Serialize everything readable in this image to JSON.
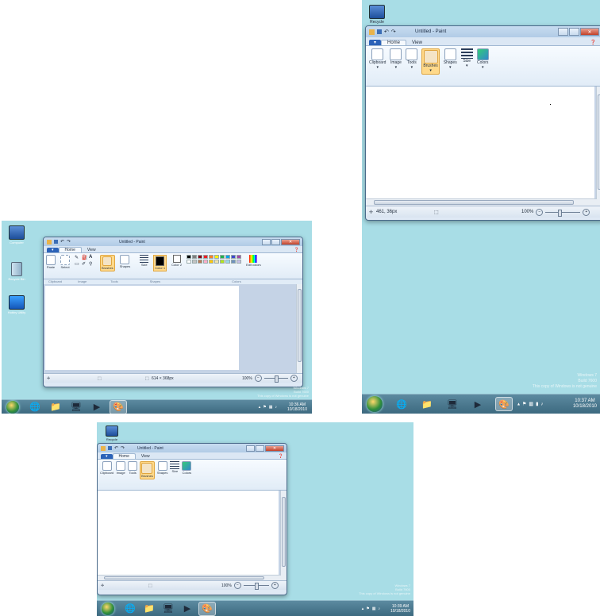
{
  "paint": {
    "title": "Untitled - Paint",
    "tabs": {
      "file": "▾",
      "home": "Home",
      "view": "View"
    },
    "ribbon_small": [
      "Clipboard",
      "Image",
      "Tools",
      "Brushes",
      "Shapes",
      "Size",
      "Colors"
    ],
    "ribbon_full": {
      "paste": "Paste",
      "select": "Select",
      "brushes": "Brushes",
      "shapes": "Shapes",
      "size": "Size",
      "color1": "Color 1",
      "color2": "Color 2",
      "edit_colors": "Edit colors",
      "groups": [
        "Clipboard",
        "Image",
        "Tools",
        "Shapes",
        "Colors"
      ]
    },
    "help_icon": "help-icon"
  },
  "shot1": {
    "desktop_icons": [
      "Computer",
      "Recycle Bin",
      "Hobby Utility"
    ],
    "status_size": "614 × 368px",
    "zoom": "100%",
    "watermark": [
      "Windows 7",
      "Build 7600",
      "This copy of Windows is not genuine"
    ],
    "clock": [
      "10:36 AM",
      "10/18/2010"
    ]
  },
  "shot2": {
    "desktop_icon": "Recycle",
    "status_pos": "461, 36px",
    "zoom": "100%",
    "watermark": [
      "Windows 7",
      "Build 7600",
      "This copy of Windows is not genuine"
    ],
    "clock": [
      "10:37 AM",
      "10/18/2010"
    ]
  },
  "shot3": {
    "desktop_icon": "Recycle",
    "zoom": "100%",
    "watermark": [
      "Windows 7",
      "Build 7600",
      "This copy of Windows is not genuine"
    ],
    "clock": [
      "10:39 AM",
      "10/18/2010"
    ]
  },
  "colors": {
    "desktop": "#a8dde6",
    "palette": [
      "#000000",
      "#7f7f7f",
      "#880015",
      "#ed1c24",
      "#ff7f27",
      "#fff200",
      "#22b14c",
      "#00a2e8",
      "#3f48cc",
      "#a349a4",
      "#ffffff",
      "#c3c3c3",
      "#b97a57",
      "#ffaec9",
      "#ffc90e",
      "#efe4b0",
      "#b5e61d",
      "#99d9ea",
      "#7092be",
      "#c8bfe7"
    ]
  }
}
